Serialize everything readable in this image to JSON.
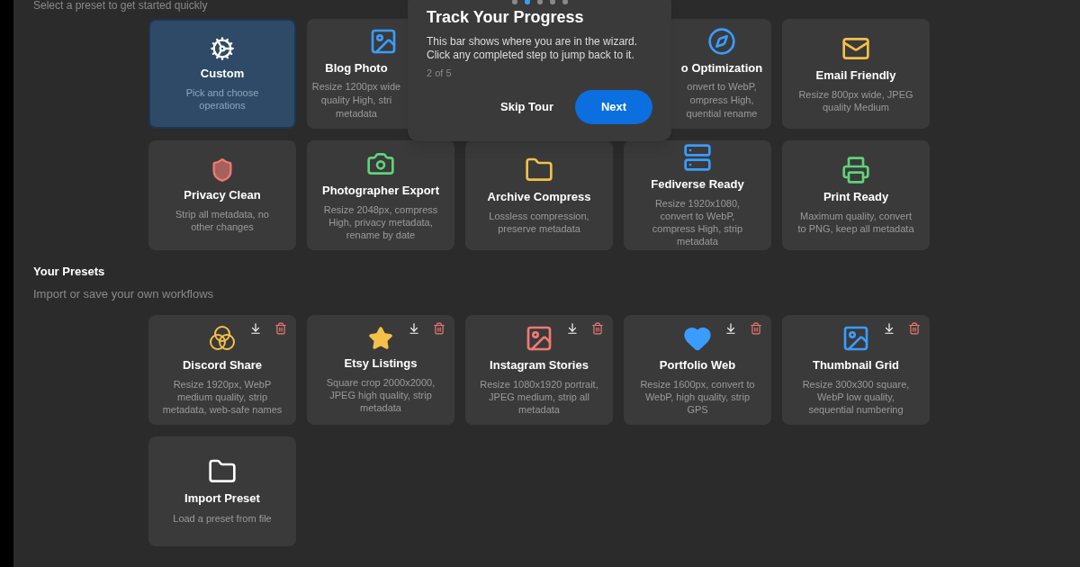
{
  "header": {
    "subtitle": "Select a preset to get started quickly"
  },
  "built_in_presets": [
    {
      "kind": "card",
      "title": "Custom",
      "description": "Pick and choose operations",
      "selected": true
    },
    {
      "kind": "covered_right",
      "title": "Blog Photo",
      "description_lines": [
        "Resize 1200px wide",
        "quality High, stri",
        "metadata"
      ],
      "selected": false
    },
    {
      "kind": "covered_left",
      "title": "o Optimization",
      "description_lines": [
        "onvert to WebP,",
        "ompress High,",
        "quential rename"
      ],
      "selected": false
    },
    {
      "kind": "card",
      "title": "Email Friendly",
      "description": "Resize 800px wide, JPEG quality Medium",
      "selected": false
    },
    {
      "kind": "card",
      "title": "Privacy Clean",
      "description": "Strip all metadata, no other changes",
      "selected": false
    },
    {
      "kind": "card",
      "title": "Photographer Export",
      "description": "Resize 2048px, compress High, privacy metadata, rename by date",
      "selected": false
    },
    {
      "kind": "card",
      "title": "Archive Compress",
      "description": "Lossless compression, preserve metadata",
      "selected": false
    },
    {
      "kind": "card",
      "title": "Fediverse Ready",
      "description": "Resize 1920x1080, convert to WebP, compress High, strip metadata",
      "selected": false
    },
    {
      "kind": "card",
      "title": "Print Ready",
      "description": "Maximum quality, convert to PNG, keep all metadata",
      "selected": false
    }
  ],
  "your_presets": {
    "title": "Your Presets",
    "subtitle": "Import or save your own workflows",
    "items": [
      {
        "title": "Discord Share",
        "description": "Resize 1920px, WebP medium quality, strip metadata, web-safe names"
      },
      {
        "title": "Etsy Listings",
        "description": "Square crop 2000x2000, JPEG high quality, strip metadata"
      },
      {
        "title": "Instagram Stories",
        "description": "Resize 1080x1920 portrait, JPEG medium, strip all metadata"
      },
      {
        "title": "Portfolio Web",
        "description": "Resize 1600px, convert to WebP, high quality, strip GPS"
      },
      {
        "title": "Thumbnail Grid",
        "description": "Resize 300x300 square, WebP low quality, sequential numbering"
      }
    ],
    "import": {
      "title": "Import Preset",
      "description": "Load a preset from file"
    }
  },
  "tour": {
    "steps": [
      {
        "selected": false
      },
      {
        "selected": true
      },
      {
        "selected": false
      },
      {
        "selected": false
      },
      {
        "selected": false
      }
    ],
    "title": "Track Your Progress",
    "body": "This bar shows where you are in the wizard. Click any completed step to jump back to it.",
    "counter": "2 of 5",
    "skip": "Skip Tour",
    "next": "Next"
  }
}
